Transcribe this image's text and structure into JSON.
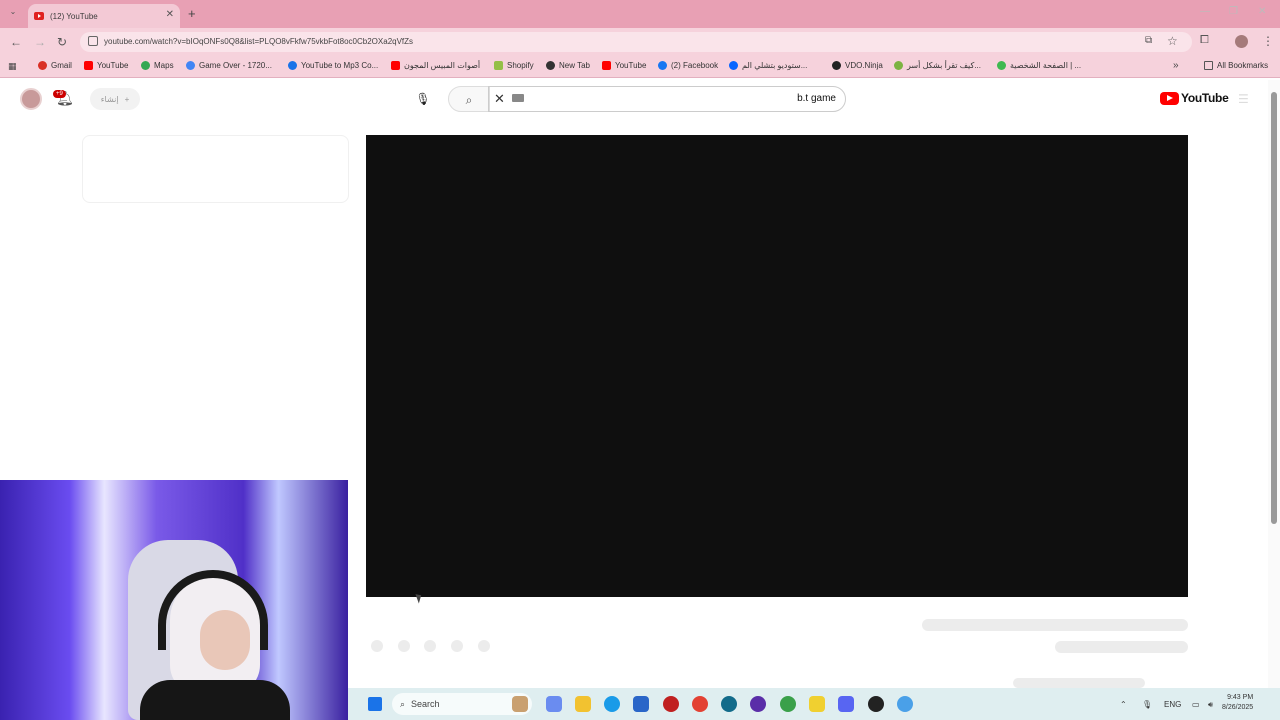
{
  "browser": {
    "tab_title": "(12) YouTube",
    "url": "youtube.com/watch?v=bIOqONFs0Q8&list=PLQO8vFkfw75vkbFot8oc0Cb2OXa2qVfZs",
    "bookmarks": [
      {
        "label": "Gmail",
        "color": "#d93025"
      },
      {
        "label": "YouTube",
        "color": "#ff0000"
      },
      {
        "label": "Maps",
        "color": "#34a853"
      },
      {
        "label": "Game Over - 1720...",
        "color": "#4285f4"
      },
      {
        "label": "YouTube to Mp3 Co...",
        "color": "#1a73e8"
      },
      {
        "label": "أصوات المبيس المجون",
        "color": "#ff0000"
      },
      {
        "label": "Shopify",
        "color": "#95bf47"
      },
      {
        "label": "New Tab",
        "color": "#333333"
      },
      {
        "label": "YouTube",
        "color": "#ff0000"
      },
      {
        "label": "(2) Facebook",
        "color": "#1877f2"
      },
      {
        "label": "ستوديو بتشلي الم...",
        "color": "#0866ff"
      },
      {
        "label": "VDO.Ninja",
        "color": "#222222"
      },
      {
        "label": "كيف تقرأ بشكل أسر...",
        "color": "#7cb342"
      },
      {
        "label": "الصفحة الشخصية | ...",
        "color": "#3fb950"
      }
    ],
    "all_bookmarks": "All Bookmarks"
  },
  "youtube": {
    "notification_count": "+9",
    "create_label": "إنشاء",
    "search_query": "b.t game",
    "logo_text": "YouTube",
    "brand_color": "#ff0000"
  },
  "taskbar": {
    "search_label": "Search",
    "language": "ENG",
    "time": "9:43 PM",
    "date": "8/26/2025"
  }
}
